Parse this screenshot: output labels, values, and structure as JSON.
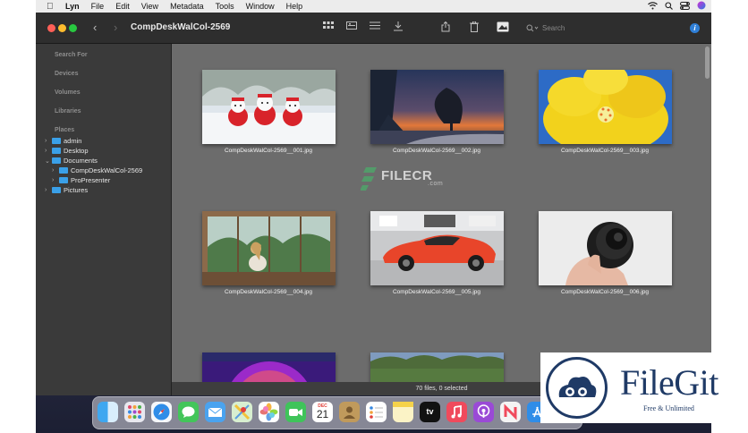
{
  "menubar": {
    "app": "Lyn",
    "items": [
      "File",
      "Edit",
      "View",
      "Metadata",
      "Tools",
      "Window",
      "Help"
    ]
  },
  "window": {
    "title": "CompDeskWalCol-2569",
    "search_placeholder": "Search"
  },
  "sidebar": {
    "sections": [
      "Search For",
      "Devices",
      "Volumes",
      "Libraries",
      "Places"
    ],
    "tree": [
      {
        "label": "admin",
        "expanded": false
      },
      {
        "label": "Desktop",
        "expanded": false
      },
      {
        "label": "Documents",
        "expanded": true
      },
      {
        "label": "CompDeskWalCol-2569",
        "expanded": false
      },
      {
        "label": "ProPresenter",
        "expanded": false
      },
      {
        "label": "Pictures",
        "expanded": false
      }
    ]
  },
  "thumbnails": [
    {
      "caption": "CompDeskWalCol-2569__001.jpg",
      "scene": "snowmen-in-snow"
    },
    {
      "caption": "CompDeskWalCol-2569__002.jpg",
      "scene": "tree-at-sunset"
    },
    {
      "caption": "CompDeskWalCol-2569__003.jpg",
      "scene": "yellow-flower"
    },
    {
      "caption": "CompDeskWalCol-2569__004.jpg",
      "scene": "woman-at-window"
    },
    {
      "caption": "CompDeskWalCol-2569__005.jpg",
      "scene": "red-sports-car"
    },
    {
      "caption": "CompDeskWalCol-2569__006.jpg",
      "scene": "camera-lens-in-hand"
    },
    {
      "caption": "",
      "scene": "purple-planet"
    },
    {
      "caption": "",
      "scene": "trees-landscape"
    }
  ],
  "status": "70 files, 0 selected",
  "watermark": {
    "text": "FILECR",
    "sub": ".com"
  },
  "filegit": {
    "name": "FileGit",
    "tagline": "Free & Unlimited"
  },
  "dock": {
    "calendar_month": "DEC",
    "calendar_day": "21",
    "tv_label": "tv"
  },
  "colors": {
    "window_bg": "#6c6c6c",
    "sidebar_bg": "#3a3a3a",
    "titlebar_bg": "#2e2e2e",
    "folder_blue": "#3aa0e8",
    "filegit_navy": "#1f3a66"
  }
}
